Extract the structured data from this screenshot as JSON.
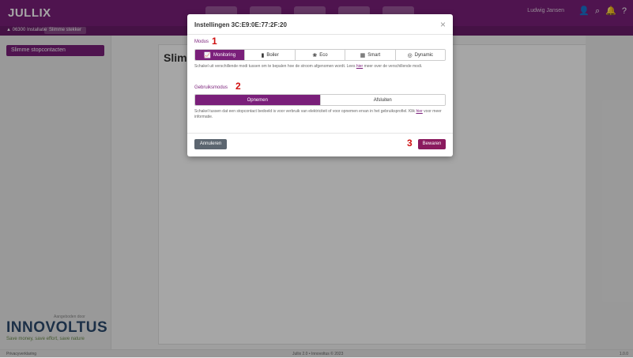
{
  "header": {
    "logo": "JULLIX",
    "user": "Ludwig Jansen",
    "icons": [
      "user-icon",
      "search-icon",
      "bell-icon",
      "help-icon"
    ]
  },
  "breadcrumb": {
    "first": "▲ 06300 Installatie",
    "second": "Slimme stekker"
  },
  "sidebar": {
    "item": "Slimme stopcontacten"
  },
  "brand": {
    "small": "Aangeboden door",
    "name": "INNOVOLTUS",
    "tagline": "Save money, save effort, save nature"
  },
  "main": {
    "title": "Slimme stopcontacten"
  },
  "footer": {
    "left": "Privacyverklaring",
    "center": "Jullix 2.0 • Innovoltus © 2023",
    "right": "1.0.0"
  },
  "modal": {
    "title": "Instellingen 3C:E9:0E:77:2F:20",
    "modus": {
      "label": "Modus",
      "annotation": "1",
      "options": [
        {
          "label": "Monitoring",
          "icon": "chart-icon",
          "glyph": "📈"
        },
        {
          "label": "Boiler",
          "icon": "boiler-icon",
          "glyph": "▮"
        },
        {
          "label": "Eco",
          "icon": "eco-icon",
          "glyph": "❀"
        },
        {
          "label": "Smart",
          "icon": "calendar-icon",
          "glyph": "▦"
        },
        {
          "label": "Dynamic",
          "icon": "dynamic-icon",
          "glyph": "◎"
        }
      ],
      "selected": "Monitoring",
      "help_text": "Schakel uit verschillende modi tussen om te bepalen hoe de stroom afgenomen wordt. Lees",
      "help_link": "hier",
      "help_suffix": "meer over de verschillende modi."
    },
    "gebruik": {
      "label": "Gebruiksmodus",
      "annotation": "2",
      "options": [
        {
          "label": "Opnemen"
        },
        {
          "label": "Afsluiten"
        }
      ],
      "selected": "Opnemen",
      "help_text": "Schakel tussen dat een stopcontact bedoeld is voor verbruik van elektriciteit of voor opnemen ervan in het gebruiksprofiel. Klik",
      "help_link": "hier",
      "help_suffix": "voor meer informatie."
    },
    "cancel_label": "Annuleren",
    "save_label": "Bewaren",
    "save_annotation": "3"
  }
}
